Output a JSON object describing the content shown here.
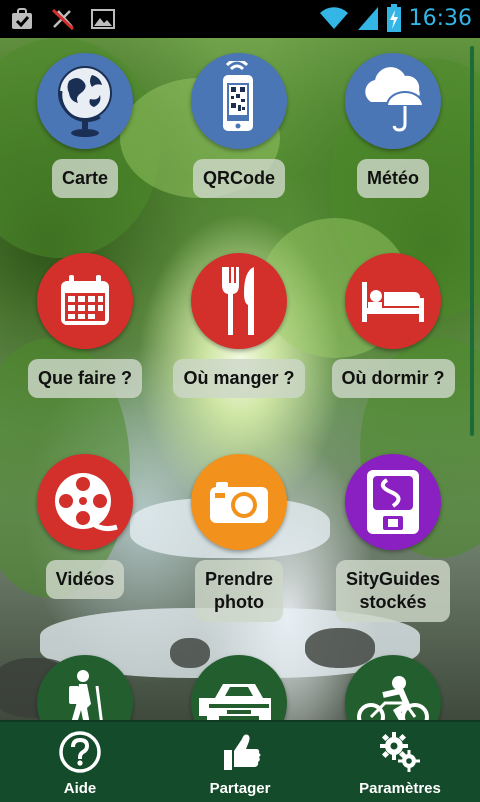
{
  "status_bar": {
    "time": "16:36",
    "left_icons": [
      "checklist-bag-icon",
      "no-connection-icon",
      "image-icon"
    ],
    "right_icons": [
      "wifi-icon",
      "signal-icon",
      "battery-charging-icon"
    ],
    "time_color": "#33b5e5"
  },
  "grid": {
    "items": [
      {
        "label": "Carte",
        "icon": "globe-icon",
        "color": "#4a76b6"
      },
      {
        "label": "QRCode",
        "icon": "phone-qr-icon",
        "color": "#4a76b6"
      },
      {
        "label": "Météo",
        "icon": "cloud-umbrella-icon",
        "color": "#4a76b6"
      },
      {
        "label": "Que faire ?",
        "icon": "calendar-icon",
        "color": "#d3302c"
      },
      {
        "label": "Où manger ?",
        "icon": "fork-knife-icon",
        "color": "#d3302c"
      },
      {
        "label": "Où dormir ?",
        "icon": "bed-icon",
        "color": "#d3302c"
      },
      {
        "label": "Vidéos",
        "icon": "film-reel-icon",
        "color": "#d3302c"
      },
      {
        "label": "Prendre photo",
        "label_line1": "Prendre",
        "label_line2": "photo",
        "icon": "camera-icon",
        "color": "#f2911b"
      },
      {
        "label": "SityGuides stockés",
        "label_line1": "SityGuides",
        "label_line2": "stockés",
        "icon": "storage-card-icon",
        "color": "#8a1fc2"
      },
      {
        "label": "",
        "icon": "hiker-icon",
        "color": "#235e2e"
      },
      {
        "label": "",
        "icon": "car-icon",
        "color": "#235e2e"
      },
      {
        "label": "",
        "icon": "cyclist-icon",
        "color": "#235e2e"
      }
    ]
  },
  "bottom_bar": {
    "tabs": [
      {
        "label": "Aide",
        "icon": "help-icon"
      },
      {
        "label": "Partager",
        "icon": "thumbs-up-icon"
      },
      {
        "label": "Paramètres",
        "icon": "gears-icon"
      }
    ],
    "background": "#144b2a"
  }
}
